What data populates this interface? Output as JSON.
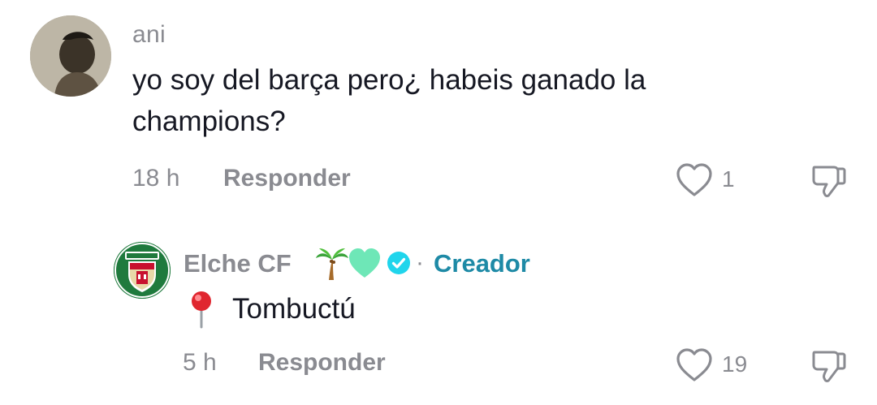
{
  "comment1": {
    "username": "ani",
    "text_line1": "yo soy del barça pero¿ habeis ganado la",
    "text_line2": "champions?",
    "time": "18 h",
    "reply_label": "Responder",
    "likes": "1"
  },
  "comment2": {
    "username": "Elche CF",
    "creator_label": "Creador",
    "separator": "·",
    "text": "Tombuctú",
    "time": "5 h",
    "reply_label": "Responder",
    "likes": "19"
  },
  "colors": {
    "primary_text": "#161823",
    "secondary_text": "#8a8b91",
    "creator_accent": "#1e8aa6",
    "verified_blue": "#20d5ec",
    "club_green": "#1f7a3d"
  },
  "icons": {
    "like": "heart-outline-icon",
    "dislike": "thumbs-down-icon",
    "verified": "verified-check-icon",
    "location": "round-pushpin-icon",
    "palm": "palm-tree-icon",
    "heart_green": "green-heart-icon"
  }
}
